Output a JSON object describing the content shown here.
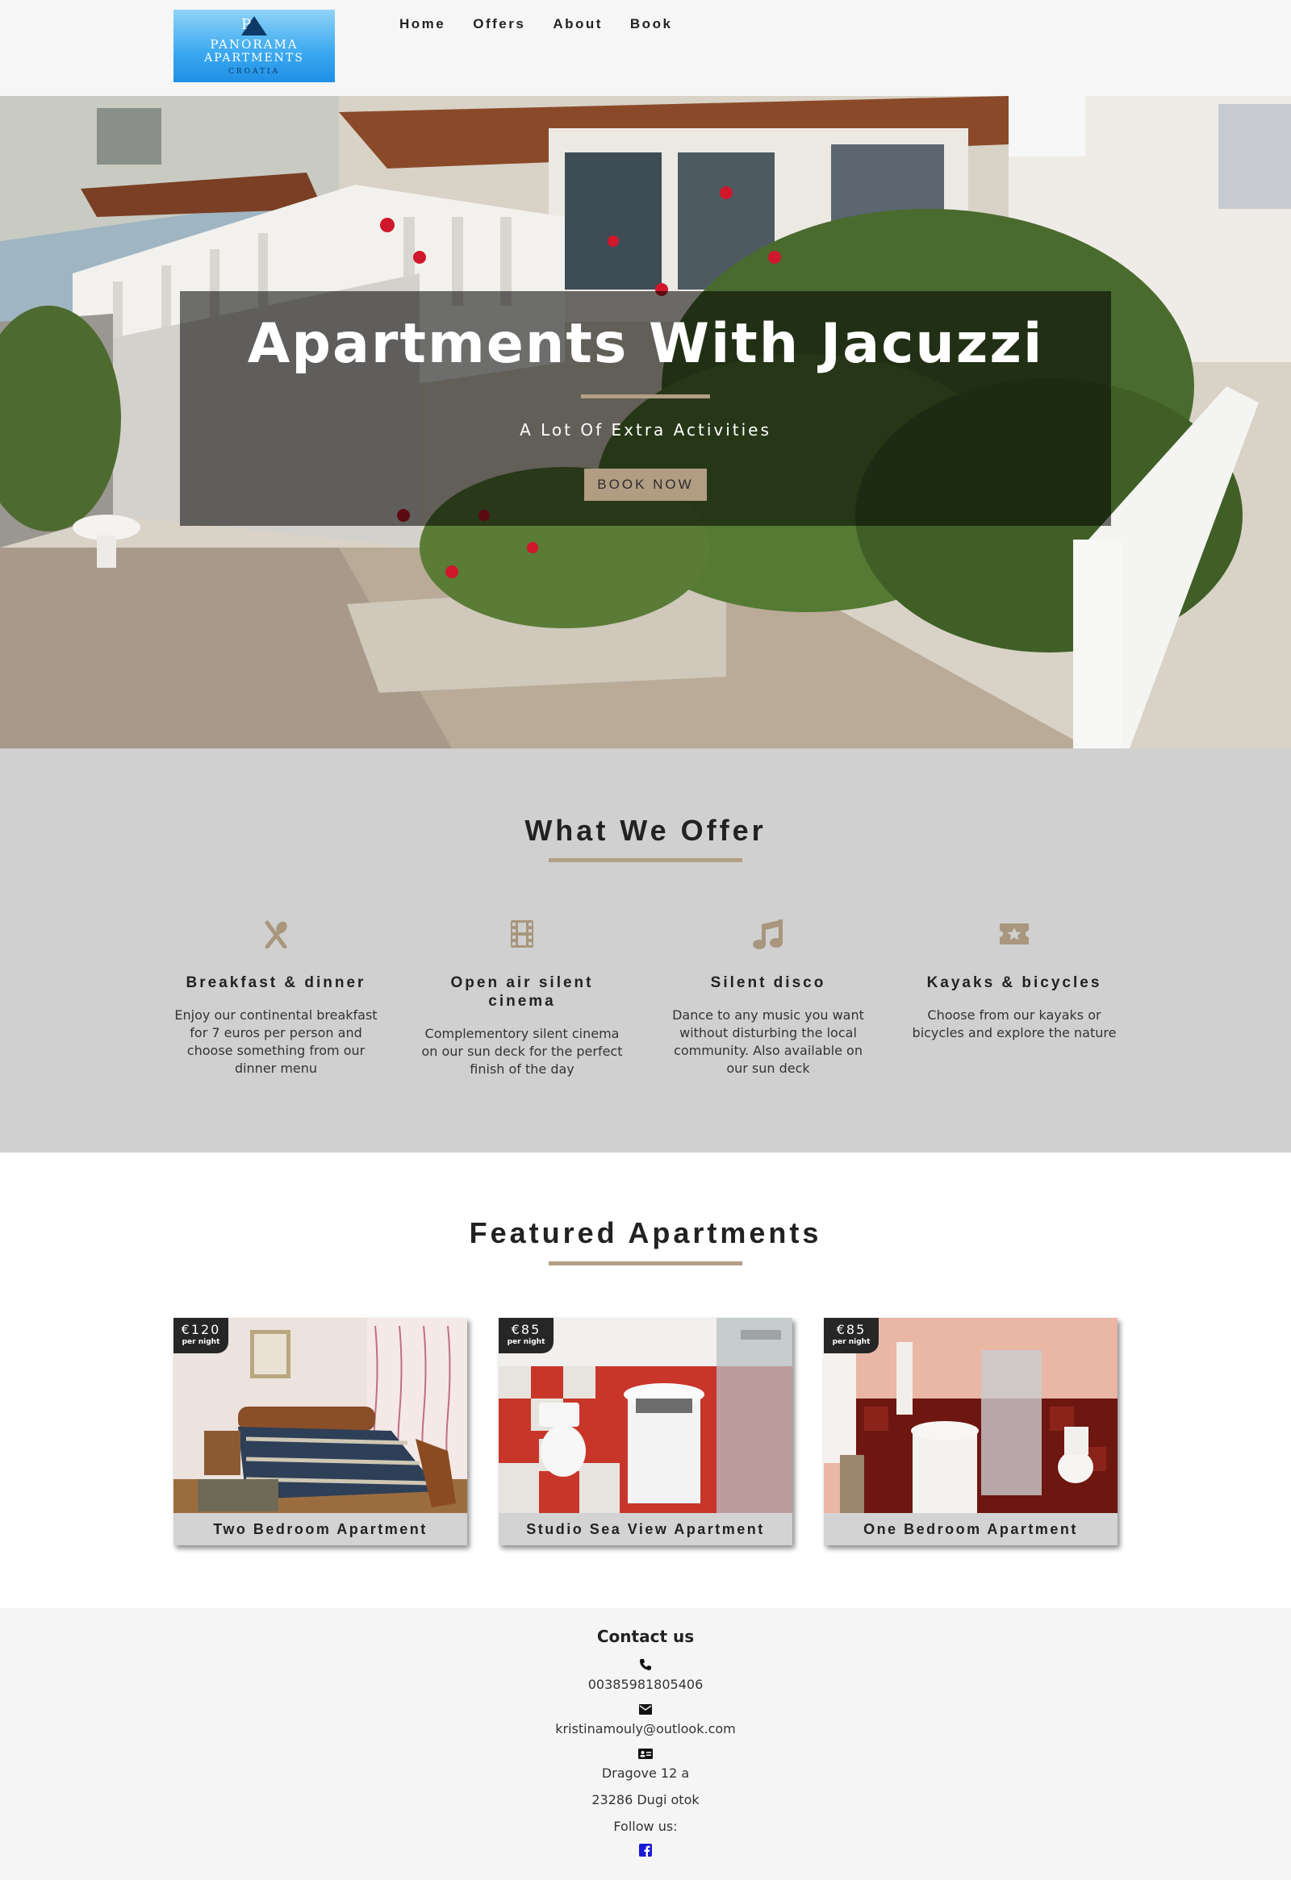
{
  "header": {
    "logo": {
      "line1": "PANORAMA",
      "line2": "APARTMENTS",
      "line3": "CROATIA"
    },
    "nav": [
      {
        "label": "Home"
      },
      {
        "label": "Offers"
      },
      {
        "label": "About"
      },
      {
        "label": "Book"
      }
    ]
  },
  "hero": {
    "title": "Apartments With Jacuzzi",
    "subtitle": "A Lot Of Extra Activities",
    "button_label": "BOOK NOW"
  },
  "offer": {
    "title": "What We Offer",
    "features": [
      {
        "icon": "utensils-icon",
        "title": "Breakfast & dinner",
        "text": "Enjoy our continental breakfast for 7 euros per person and choose something from our dinner menu"
      },
      {
        "icon": "film-icon",
        "title": "Open air silent cinema",
        "text": "Complementory silent cinema on our sun deck for the perfect finish of the day"
      },
      {
        "icon": "music-icon",
        "title": "Silent disco",
        "text": "Dance to any music you want without disturbing the local community. Also available on our sun deck"
      },
      {
        "icon": "ticket-icon",
        "title": "Kayaks & bicycles",
        "text": "Choose from our kayaks or bicycles and explore the nature"
      }
    ]
  },
  "featured": {
    "title": "Featured Apartments",
    "cards": [
      {
        "price": "€120",
        "per": "per night",
        "name": "Two Bedroom Apartment"
      },
      {
        "price": "€85",
        "per": "per night",
        "name": "Studio Sea View Apartment"
      },
      {
        "price": "€85",
        "per": "per night",
        "name": "One Bedroom Apartment"
      }
    ]
  },
  "footer": {
    "title": "Contact us",
    "phone": "00385981805406",
    "email": "kristinamouly@outlook.com",
    "address1": "Dragove 12 a",
    "address2": "23286 Dugi otok",
    "follow": "Follow us:"
  },
  "colors": {
    "accent": "#b29f85",
    "offer_bg": "#d0d0d0",
    "facebook": "#1a1ad6"
  }
}
